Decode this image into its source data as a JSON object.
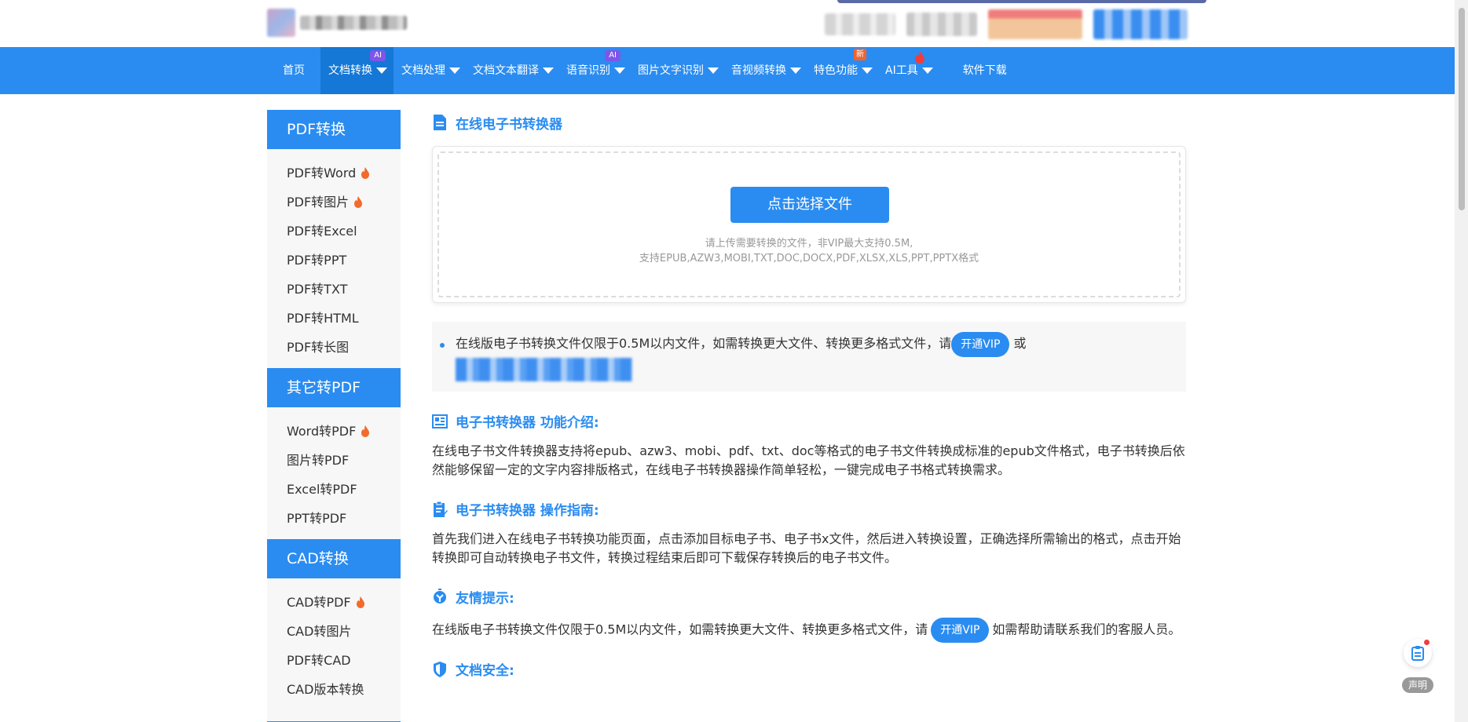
{
  "header": {
    "logo_alt": "site-logo"
  },
  "nav": {
    "items": [
      {
        "label": "首页"
      },
      {
        "label": "文档转换",
        "badge": "AI"
      },
      {
        "label": "文档处理"
      },
      {
        "label": "文档文本翻译"
      },
      {
        "label": "语音识别",
        "badge": "AI"
      },
      {
        "label": "图片文字识别"
      },
      {
        "label": "音视频转换"
      },
      {
        "label": "特色功能",
        "badge": "新"
      },
      {
        "label": "AI工具"
      },
      {
        "label": "软件下载"
      }
    ]
  },
  "sidebar": {
    "groups": [
      {
        "title": "PDF转换",
        "items": [
          "PDF转Word",
          "PDF转图片",
          "PDF转Excel",
          "PDF转PPT",
          "PDF转TXT",
          "PDF转HTML",
          "PDF转长图"
        ]
      },
      {
        "title": "其它转PDF",
        "items": [
          "Word转PDF",
          "图片转PDF",
          "Excel转PDF",
          "PPT转PDF"
        ]
      },
      {
        "title": "CAD转换",
        "items": [
          "CAD转PDF",
          "CAD转图片",
          "PDF转CAD",
          "CAD版本转换"
        ]
      }
    ]
  },
  "main": {
    "title": "在线电子书转换器",
    "upload_button": "点击选择文件",
    "upload_hint_1": "请上传需要转换的文件，非VIP最大支持0.5M,",
    "upload_hint_2": "支持EPUB,AZW3,MOBI,TXT,DOC,DOCX,PDF,XLSX,XLS,PPT,PPTX格式",
    "notice_text": "在线版电子书转换文件仅限于0.5M以内文件，如需转换更大文件、转换更多格式文件，请",
    "notice_vip": "开通VIP",
    "notice_or": "或",
    "intro_title": "电子书转换器 功能介绍:",
    "intro_text": "在线电子书文件转换器支持将epub、azw3、mobi、pdf、txt、doc等格式的电子书文件转换成标准的epub文件格式，电子书转换后依然能够保留一定的文字内容排版格式，在线电子书转换器操作简单轻松，一键完成电子书格式转换需求。",
    "guide_title": "电子书转换器 操作指南:",
    "guide_text": "首先我们进入在线电子书转换功能页面，点击添加目标电子书、电子书x文件，然后进入转换设置，正确选择所需输出的格式，点击开始转换即可自动转换电子书文件，转换过程结束后即可下载保存转换后的电子书文件。",
    "tip_title": "友情提示:",
    "tip_text_1": "在线版电子书转换文件仅限于0.5M以内文件，如需转换更大文件、转换更多格式文件，请",
    "tip_vip": "开通VIP",
    "tip_text_2": "如需帮助请联系我们的客服人员。",
    "security_title": "文档安全:"
  },
  "float": {
    "label": "声明"
  },
  "colors": {
    "primary": "#2a8cf0",
    "nav_active": "#1577d6",
    "ai_badge": "#7f56e8",
    "new_badge": "#f0642f",
    "fire": "#f26b2c"
  }
}
